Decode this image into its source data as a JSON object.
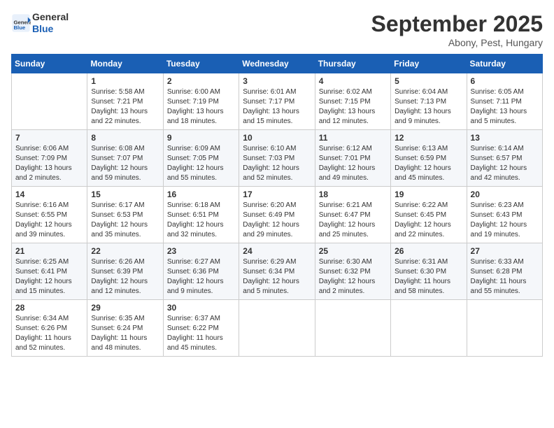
{
  "logo": {
    "line1": "General",
    "line2": "Blue"
  },
  "title": "September 2025",
  "subtitle": "Abony, Pest, Hungary",
  "header_days": [
    "Sunday",
    "Monday",
    "Tuesday",
    "Wednesday",
    "Thursday",
    "Friday",
    "Saturday"
  ],
  "weeks": [
    [
      {
        "day": "",
        "info": ""
      },
      {
        "day": "1",
        "info": "Sunrise: 5:58 AM\nSunset: 7:21 PM\nDaylight: 13 hours\nand 22 minutes."
      },
      {
        "day": "2",
        "info": "Sunrise: 6:00 AM\nSunset: 7:19 PM\nDaylight: 13 hours\nand 18 minutes."
      },
      {
        "day": "3",
        "info": "Sunrise: 6:01 AM\nSunset: 7:17 PM\nDaylight: 13 hours\nand 15 minutes."
      },
      {
        "day": "4",
        "info": "Sunrise: 6:02 AM\nSunset: 7:15 PM\nDaylight: 13 hours\nand 12 minutes."
      },
      {
        "day": "5",
        "info": "Sunrise: 6:04 AM\nSunset: 7:13 PM\nDaylight: 13 hours\nand 9 minutes."
      },
      {
        "day": "6",
        "info": "Sunrise: 6:05 AM\nSunset: 7:11 PM\nDaylight: 13 hours\nand 5 minutes."
      }
    ],
    [
      {
        "day": "7",
        "info": "Sunrise: 6:06 AM\nSunset: 7:09 PM\nDaylight: 13 hours\nand 2 minutes."
      },
      {
        "day": "8",
        "info": "Sunrise: 6:08 AM\nSunset: 7:07 PM\nDaylight: 12 hours\nand 59 minutes."
      },
      {
        "day": "9",
        "info": "Sunrise: 6:09 AM\nSunset: 7:05 PM\nDaylight: 12 hours\nand 55 minutes."
      },
      {
        "day": "10",
        "info": "Sunrise: 6:10 AM\nSunset: 7:03 PM\nDaylight: 12 hours\nand 52 minutes."
      },
      {
        "day": "11",
        "info": "Sunrise: 6:12 AM\nSunset: 7:01 PM\nDaylight: 12 hours\nand 49 minutes."
      },
      {
        "day": "12",
        "info": "Sunrise: 6:13 AM\nSunset: 6:59 PM\nDaylight: 12 hours\nand 45 minutes."
      },
      {
        "day": "13",
        "info": "Sunrise: 6:14 AM\nSunset: 6:57 PM\nDaylight: 12 hours\nand 42 minutes."
      }
    ],
    [
      {
        "day": "14",
        "info": "Sunrise: 6:16 AM\nSunset: 6:55 PM\nDaylight: 12 hours\nand 39 minutes."
      },
      {
        "day": "15",
        "info": "Sunrise: 6:17 AM\nSunset: 6:53 PM\nDaylight: 12 hours\nand 35 minutes."
      },
      {
        "day": "16",
        "info": "Sunrise: 6:18 AM\nSunset: 6:51 PM\nDaylight: 12 hours\nand 32 minutes."
      },
      {
        "day": "17",
        "info": "Sunrise: 6:20 AM\nSunset: 6:49 PM\nDaylight: 12 hours\nand 29 minutes."
      },
      {
        "day": "18",
        "info": "Sunrise: 6:21 AM\nSunset: 6:47 PM\nDaylight: 12 hours\nand 25 minutes."
      },
      {
        "day": "19",
        "info": "Sunrise: 6:22 AM\nSunset: 6:45 PM\nDaylight: 12 hours\nand 22 minutes."
      },
      {
        "day": "20",
        "info": "Sunrise: 6:23 AM\nSunset: 6:43 PM\nDaylight: 12 hours\nand 19 minutes."
      }
    ],
    [
      {
        "day": "21",
        "info": "Sunrise: 6:25 AM\nSunset: 6:41 PM\nDaylight: 12 hours\nand 15 minutes."
      },
      {
        "day": "22",
        "info": "Sunrise: 6:26 AM\nSunset: 6:39 PM\nDaylight: 12 hours\nand 12 minutes."
      },
      {
        "day": "23",
        "info": "Sunrise: 6:27 AM\nSunset: 6:36 PM\nDaylight: 12 hours\nand 9 minutes."
      },
      {
        "day": "24",
        "info": "Sunrise: 6:29 AM\nSunset: 6:34 PM\nDaylight: 12 hours\nand 5 minutes."
      },
      {
        "day": "25",
        "info": "Sunrise: 6:30 AM\nSunset: 6:32 PM\nDaylight: 12 hours\nand 2 minutes."
      },
      {
        "day": "26",
        "info": "Sunrise: 6:31 AM\nSunset: 6:30 PM\nDaylight: 11 hours\nand 58 minutes."
      },
      {
        "day": "27",
        "info": "Sunrise: 6:33 AM\nSunset: 6:28 PM\nDaylight: 11 hours\nand 55 minutes."
      }
    ],
    [
      {
        "day": "28",
        "info": "Sunrise: 6:34 AM\nSunset: 6:26 PM\nDaylight: 11 hours\nand 52 minutes."
      },
      {
        "day": "29",
        "info": "Sunrise: 6:35 AM\nSunset: 6:24 PM\nDaylight: 11 hours\nand 48 minutes."
      },
      {
        "day": "30",
        "info": "Sunrise: 6:37 AM\nSunset: 6:22 PM\nDaylight: 11 hours\nand 45 minutes."
      },
      {
        "day": "",
        "info": ""
      },
      {
        "day": "",
        "info": ""
      },
      {
        "day": "",
        "info": ""
      },
      {
        "day": "",
        "info": ""
      }
    ]
  ]
}
